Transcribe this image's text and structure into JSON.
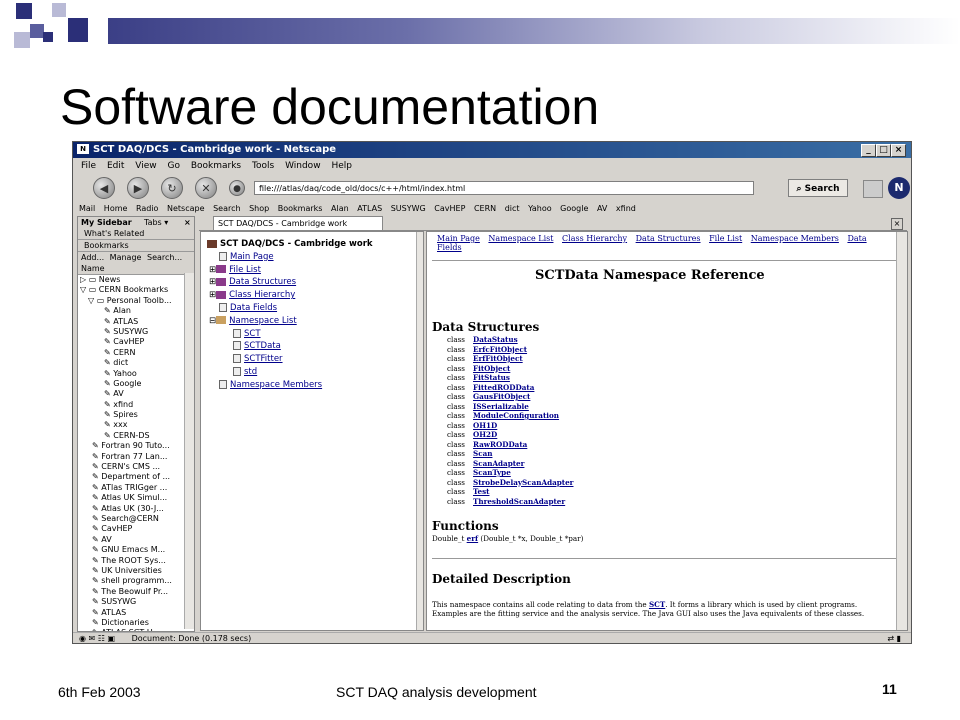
{
  "slide": {
    "title": "Software documentation",
    "footer_date": "6th Feb 2003",
    "footer_center": "SCT DAQ analysis development",
    "page_number": "11"
  },
  "window": {
    "title": "SCT DAQ/DCS - Cambridge work - Netscape",
    "menu": [
      "File",
      "Edit",
      "View",
      "Go",
      "Bookmarks",
      "Tools",
      "Window",
      "Help"
    ],
    "url": "file:///atlas/daq/code_old/docs/c++/html/index.html",
    "search_label": "Search",
    "personal_bar": [
      "Mail",
      "Home",
      "Radio",
      "Netscape",
      "Search",
      "Shop",
      "Bookmarks",
      "Alan",
      "ATLAS",
      "SUSYWG",
      "CavHEP",
      "CERN",
      "dict",
      "Yahoo",
      "Google",
      "AV",
      "xfind"
    ],
    "status": "Document: Done (0.178 secs)"
  },
  "sidebar": {
    "title": "My Sidebar",
    "tabs_label": "Tabs",
    "whats_related": "What's Related",
    "bookmarks_tab": "Bookmarks",
    "buttons": [
      "Add...",
      "Manage",
      "Search..."
    ],
    "name_header": "Name",
    "tree": [
      "News",
      "CERN Bookmarks",
      "Personal Toolb...",
      "Alan",
      "ATLAS",
      "SUSYWG",
      "CavHEP",
      "CERN",
      "dict",
      "Yahoo",
      "Google",
      "AV",
      "xfind",
      "Spires",
      "xxx",
      "CERN-DS",
      "Fortran 90 Tuto...",
      "Fortran 77 Lan...",
      "CERN's CMS ...",
      "Department of ...",
      "ATlas TRIGger ...",
      "Atlas UK Simul...",
      "Atlas UK (30-J...",
      "Search@CERN",
      "CavHEP",
      "AV",
      "GNU Emacs M...",
      "The ROOT Sys...",
      "UK Universities",
      "shell programm...",
      "The Beowulf Pr...",
      "SUSYWG",
      "ATLAS",
      "Dictionaries",
      "ATLAS SCT U..."
    ]
  },
  "tab": {
    "label": "SCT DAQ/DCS - Cambridge work"
  },
  "toc": {
    "root": "SCT DAQ/DCS - Cambridge work",
    "items": [
      "Main Page",
      "File List",
      "Data Structures",
      "Class Hierarchy",
      "Data Fields",
      "Namespace List"
    ],
    "namespaces": [
      "SCT",
      "SCTData",
      "SCTFitter",
      "std"
    ],
    "last": "Namespace Members"
  },
  "content": {
    "nav_links": [
      "Main Page",
      "Namespace List",
      "Class Hierarchy",
      "Data Structures",
      "File List",
      "Namespace Members",
      "Data Fields"
    ],
    "heading": "SCTData Namespace Reference",
    "data_structures_heading": "Data Structures",
    "class_keyword": "class",
    "classes": [
      "DataStatus",
      "ErfcFitObject",
      "ErfFitObject",
      "FitObject",
      "FitStatus",
      "FittedRODData",
      "GausFitObject",
      "ISSerializable",
      "ModuleConfiguration",
      "OH1D",
      "OH2D",
      "RawRODData",
      "Scan",
      "ScanAdapter",
      "ScanType",
      "StrobeDelayScanAdapter",
      "Test",
      "ThresholdScanAdapter"
    ],
    "functions_heading": "Functions",
    "function_ret": "Double_t",
    "function_name": "erf",
    "function_args": "(Double_t *x, Double_t *par)",
    "detailed_heading": "Detailed Description",
    "desc_pre": "This namespace contains all code relating to data from the",
    "desc_link": "SCT",
    "desc_post": ". It forms a library which is used by client programs. Examples are the fitting service and the analysis service. The Java GUI also uses the Java equivalents of these classes."
  }
}
